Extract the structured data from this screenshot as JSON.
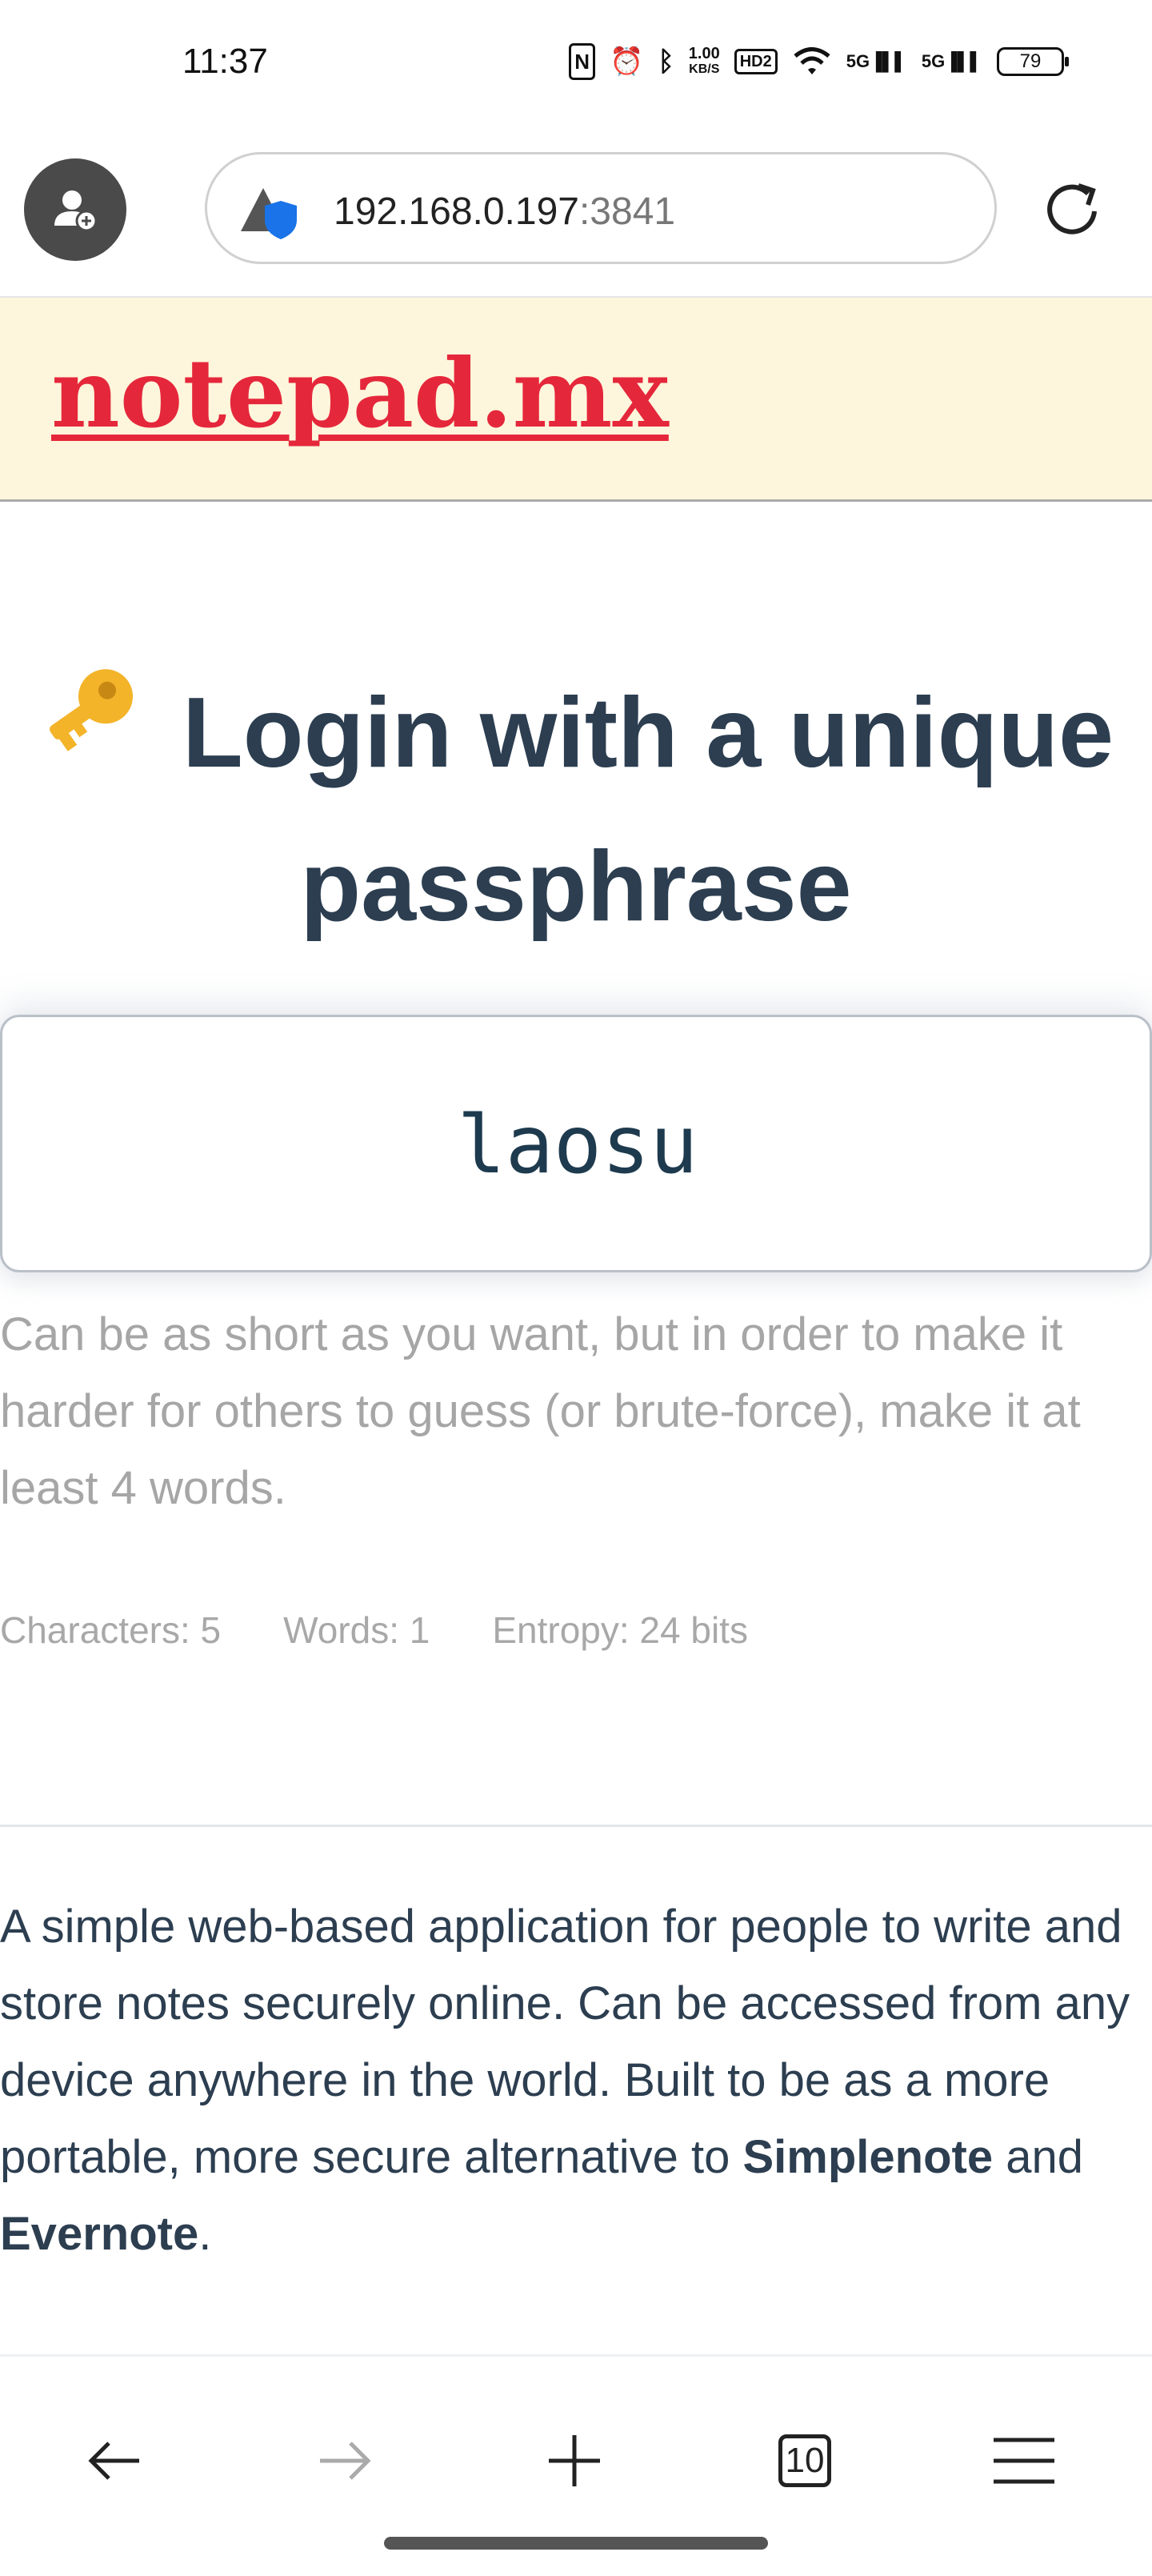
{
  "status_bar": {
    "time": "11:37",
    "net_speed_value": "1.00",
    "net_speed_unit": "KB/S",
    "hd_label": "HD2",
    "signal_1": "5G",
    "signal_2": "5G",
    "battery": "79"
  },
  "browser": {
    "url_host": "192.168.0.197",
    "url_port": ":3841",
    "tabs_count": "10"
  },
  "site": {
    "logo": "notepad.mx"
  },
  "login": {
    "heading": "Login with a unique passphrase",
    "passphrase_value": "laosu",
    "hint": "Can be as short as you want, but in order to make it harder for others to guess (or brute-force), make it at least 4 words.",
    "stats": {
      "characters": "Characters: 5",
      "words": "Words: 1",
      "entropy": "Entropy: 24 bits"
    }
  },
  "about": {
    "text_part1": "A simple web-based application for people to write and store notes securely online. Can be accessed from any device anywhere in the world. Built to be as a more portable, more secure alternative to ",
    "simplenote": "Simplenote",
    "and": " and ",
    "evernote": "Evernote",
    "period": "."
  },
  "colors": {
    "logo": "#e5273b",
    "header_bg": "#fdf6dc",
    "heading": "#2c3e50",
    "hint": "#a6a6a6"
  },
  "icons": {
    "key": "key-icon",
    "back": "arrow-left-icon",
    "forward": "arrow-right-icon",
    "new_tab": "plus-icon",
    "menu": "hamburger-menu-icon",
    "reload": "reload-icon",
    "site_security": "shield-warning-icon",
    "profile": "add-user-icon"
  }
}
